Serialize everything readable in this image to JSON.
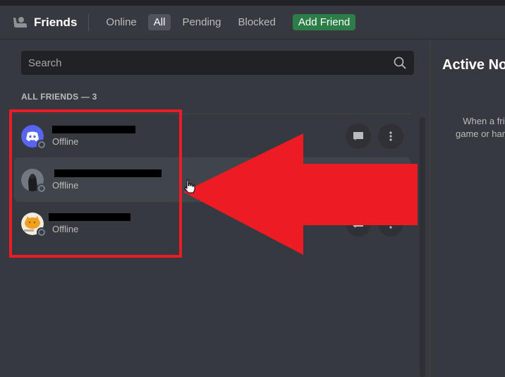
{
  "header": {
    "title": "Friends",
    "tabs": [
      {
        "label": "Online",
        "active": false
      },
      {
        "label": "All",
        "active": true
      },
      {
        "label": "Pending",
        "active": false
      },
      {
        "label": "Blocked",
        "active": false
      }
    ],
    "add_friend_label": "Add Friend"
  },
  "search": {
    "placeholder": "Search",
    "value": ""
  },
  "friends_list": {
    "section_title": "ALL FRIENDS — 3",
    "items": [
      {
        "name": "[redacted]",
        "status": "Offline",
        "avatar": "discord-default-blue"
      },
      {
        "name": "[redacted]",
        "status": "Offline",
        "avatar": "dark-figure-photo"
      },
      {
        "name": "[redacted]",
        "status": "Offline",
        "avatar": "orange-cat-drawing"
      }
    ]
  },
  "right_panel": {
    "title": "Active Now",
    "description_lines": [
      "When a friend starts an activity—like playing a",
      "game or hanging out on voice—we'll show it here!"
    ]
  },
  "annotations": {
    "highlight_color": "#ed1c24",
    "arrow_direction": "left"
  },
  "colors": {
    "background": "#36393f",
    "add_friend_green": "#2d7d46",
    "blurple": "#5865f2",
    "offline_gray": "#747f8d"
  }
}
